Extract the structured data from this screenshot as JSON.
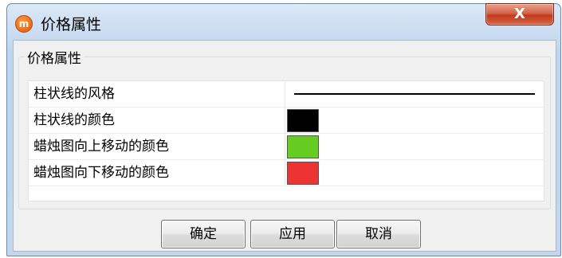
{
  "window": {
    "title": "价格属性",
    "close_label": "X"
  },
  "group": {
    "legend": "价格属性"
  },
  "properties": [
    {
      "label": "柱状线的风格",
      "type": "line",
      "color": "#000000"
    },
    {
      "label": "柱状线的颜色",
      "type": "color",
      "color": "#000000"
    },
    {
      "label": "蜡烛图向上移动的颜色",
      "type": "color",
      "color": "#66cc22"
    },
    {
      "label": "蜡烛图向下移动的颜色",
      "type": "color",
      "color": "#ee3333"
    }
  ],
  "buttons": {
    "ok": "确定",
    "apply": "应用",
    "cancel": "取消"
  }
}
